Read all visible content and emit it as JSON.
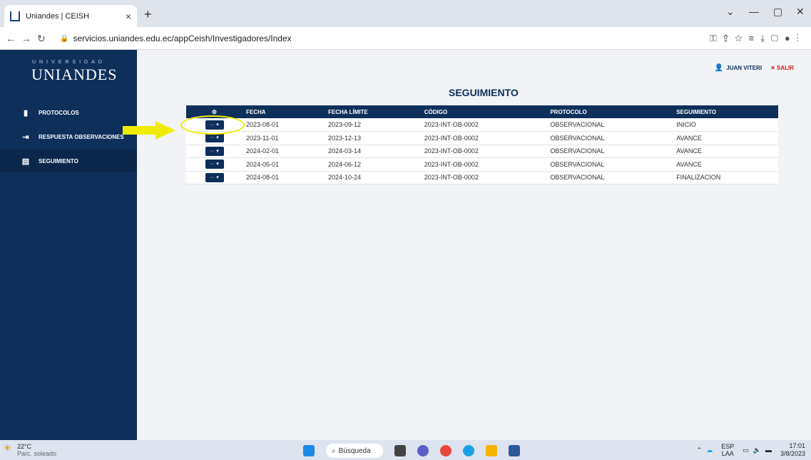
{
  "browser": {
    "tab_title": "Uniandes | CEISH",
    "tab_close": "×",
    "new_tab": "+",
    "url": "servicios.uniandes.edu.ec/appCeish/Investigadores/Index"
  },
  "sidebar": {
    "logo_top": "UNIVERSIDAD",
    "logo": "UNIANDES",
    "items": [
      {
        "label": "PROTOCOLOS",
        "icon": "document-icon"
      },
      {
        "label": "RESPUESTA OBSERVACIONES",
        "icon": "sign-in-icon"
      },
      {
        "label": "SEGUIMIENTO",
        "icon": "file-text-icon"
      }
    ]
  },
  "header": {
    "user": "JUAN VITERI",
    "logout": "SALIR"
  },
  "page_title": "SEGUIMIENTO",
  "table": {
    "columns": [
      "FECHA",
      "FECHA LÍMITE",
      "CÓDIGO",
      "PROTOCOLO",
      "SEGUIMIENTO"
    ],
    "rows": [
      [
        "2023-08-01",
        "2023-09-12",
        "2023-INT-OB-0002",
        "OBSERVACIONAL",
        "INICIO"
      ],
      [
        "2023-11-01",
        "2023-12-13",
        "2023-INT-OB-0002",
        "OBSERVACIONAL",
        "AVANCE"
      ],
      [
        "2024-02-01",
        "2024-03-14",
        "2023-INT-OB-0002",
        "OBSERVACIONAL",
        "AVANCE"
      ],
      [
        "2024-05-01",
        "2024-06-12",
        "2023-INT-OB-0002",
        "OBSERVACIONAL",
        "AVANCE"
      ],
      [
        "2024-08-01",
        "2024-10-24",
        "2023-INT-OB-0002",
        "OBSERVACIONAL",
        "FINALIZACION"
      ]
    ],
    "action_label": "··· ▾"
  },
  "taskbar": {
    "temp": "22°C",
    "weather": "Parc. soleado",
    "search": "Búsqueda",
    "lang1": "ESP",
    "lang2": "LAA",
    "time": "17:01",
    "date": "3/8/2023"
  },
  "colors": {
    "sidebar": "#0e2f5a",
    "accent_red": "#d41919",
    "highlight": "#f0ec00"
  }
}
